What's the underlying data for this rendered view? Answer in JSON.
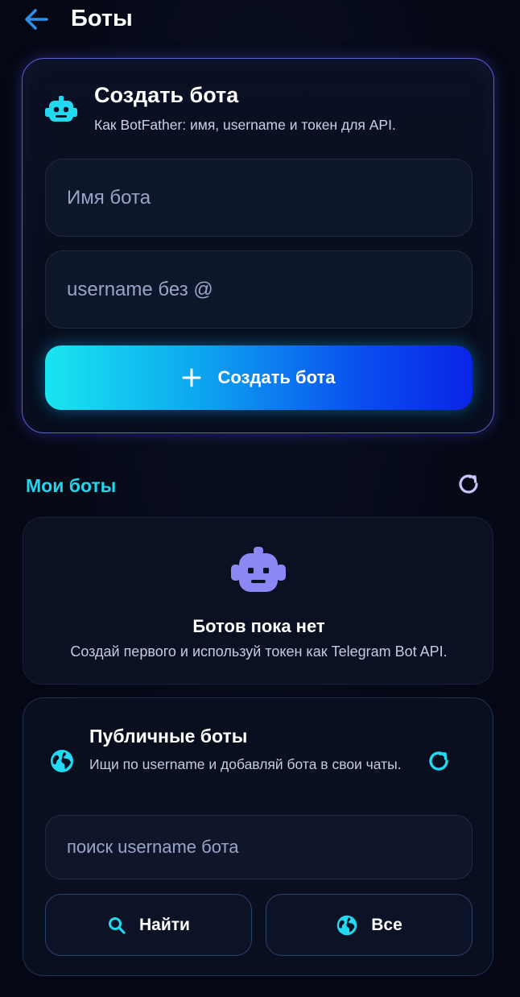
{
  "header": {
    "title": "Боты",
    "back_icon": "arrow-left-icon"
  },
  "create_card": {
    "icon": "robot-icon",
    "title": "Создать бота",
    "subtitle": "Как BotFather: имя, username и токен для API.",
    "name_placeholder": "Имя бота",
    "username_placeholder": "username без @",
    "button_label": "Создать бота",
    "button_icon": "plus-icon"
  },
  "my_bots": {
    "title": "Мои боты",
    "refresh_icon": "refresh-icon",
    "empty_title": "Ботов пока нет",
    "empty_subtitle": "Создай первого и используй токен как Telegram Bot API."
  },
  "public_bots": {
    "icon": "globe-icon",
    "title": "Публичные боты",
    "subtitle": "Ищи по username и добавляй бота в свои чаты.",
    "search_placeholder": "поиск username бота",
    "find_label": "Найти",
    "find_icon": "search-icon",
    "all_label": "Все",
    "all_icon": "globe-icon"
  },
  "colors": {
    "background": "#050814",
    "accent_cyan": "#1fd7ee",
    "accent_blue": "#0b23e6",
    "accent_purple": "#5b5fd6",
    "robot_purple": "#8b87f3"
  }
}
